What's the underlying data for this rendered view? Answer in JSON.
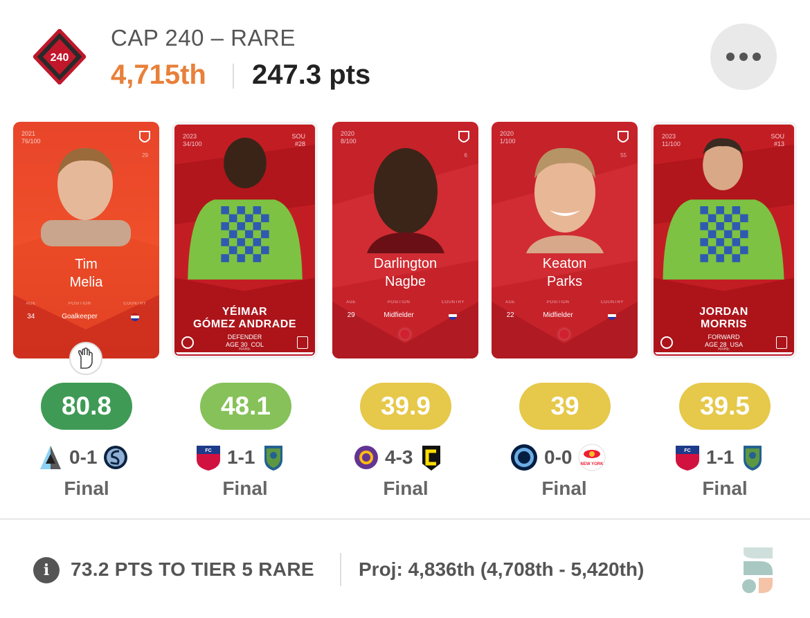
{
  "header": {
    "title": "CAP 240 – RARE",
    "logo_text": "240",
    "rank": "4,715th",
    "points": "247.3 pts",
    "more_icon": "more-horizontal-icon"
  },
  "cards": [
    {
      "year": "2021",
      "serial": "76/100",
      "club_number": "29",
      "name_line1": "Tim",
      "name_line2": "Melia",
      "age_label": "AGE",
      "position_label": "POSITION",
      "country_label": "COUNTRY",
      "age": "34",
      "position": "Goalkeeper",
      "score": "80.8",
      "score_color": "#3f9a55",
      "home_score": "0-1",
      "status": "Final",
      "home_team": "Minnesota United",
      "away_team": "Sporting Kansas City",
      "badge_icon": "goalkeeper-glove-icon"
    },
    {
      "year": "2023",
      "serial": "34/100",
      "club_code": "SOU",
      "club_number": "#28",
      "name_line1": "YÉIMAR",
      "name_line2": "GÓMEZ ANDRADE",
      "position": "DEFENDER",
      "age_line": "AGE 30",
      "country": "COL",
      "rarity": "RARE",
      "score": "48.1",
      "score_color": "#86c159",
      "home_score": "1-1",
      "status": "Final",
      "home_team": "FC Dallas",
      "away_team": "Seattle Sounders"
    },
    {
      "year": "2020",
      "serial": "8/100",
      "club_number": "6",
      "name_line1": "Darlington",
      "name_line2": "Nagbe",
      "age_label": "AGE",
      "position_label": "POSITION",
      "country_label": "COUNTRY",
      "age": "29",
      "position": "Midfielder",
      "score": "39.9",
      "score_color": "#e6c84a",
      "home_score": "4-3",
      "status": "Final",
      "home_team": "Orlando City",
      "away_team": "Columbus Crew"
    },
    {
      "year": "2020",
      "serial": "1/100",
      "club_number": "55",
      "name_line1": "Keaton",
      "name_line2": "Parks",
      "age_label": "AGE",
      "position_label": "POSITION",
      "country_label": "COUNTRY",
      "age": "22",
      "position": "Midfielder",
      "score": "39",
      "score_color": "#e6c84a",
      "home_score": "0-0",
      "status": "Final",
      "home_team": "New York City FC",
      "away_team": "New York Red Bulls"
    },
    {
      "year": "2023",
      "serial": "11/100",
      "club_code": "SOU",
      "club_number": "#13",
      "name_line1": "JORDAN",
      "name_line2": "MORRIS",
      "position": "FORWARD",
      "age_line": "AGE 28",
      "country": "USA",
      "rarity": "RARE",
      "score": "39.5",
      "score_color": "#e6c84a",
      "home_score": "1-1",
      "status": "Final",
      "home_team": "FC Dallas",
      "away_team": "Seattle Sounders"
    }
  ],
  "footer": {
    "info_icon": "info-icon",
    "info_glyph": "i",
    "tier_text": "73.2 PTS TO TIER 5 RARE",
    "projection": "Proj: 4,836th (4,708th - 5,420th)",
    "brand_icon": "sorare-data-logo-icon"
  }
}
